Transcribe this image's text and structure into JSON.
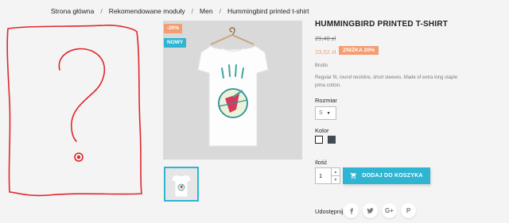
{
  "breadcrumb": {
    "items": [
      "Strona główna",
      "Rekomendowane moduły",
      "Men",
      "Hummingbird printed t-shirt"
    ],
    "separator": "/"
  },
  "product": {
    "title": "HUMMINGBIRD PRINTED T-SHIRT",
    "old_price": "29,40 zł",
    "new_price": "23,52 zł",
    "discount_label": "ZNIŻKA 20%",
    "tax_label": "Brutto",
    "description": "Regular fit, round neckline, short sleeves. Made of extra long staple pima cotton."
  },
  "badges": {
    "discount": "-20%",
    "new": "NOWY"
  },
  "options": {
    "size_label": "Rozmiar",
    "size_value": "S",
    "color_label": "Kolor",
    "colors": [
      "#ffffff",
      "#434a54"
    ]
  },
  "quantity": {
    "label": "Ilość",
    "value": "1"
  },
  "cart": {
    "button_label": "DODAJ DO KOSZYKA"
  },
  "share": {
    "label": "Udostępnij",
    "networks": [
      "facebook-icon",
      "twitter-icon",
      "google-plus-icon",
      "pinterest-icon"
    ],
    "gplus_glyph": "G+",
    "pinterest_glyph": "P"
  },
  "colors": {
    "accent": "#2fb5d2",
    "discount": "#f39d72",
    "doodle": "#e0262b"
  }
}
